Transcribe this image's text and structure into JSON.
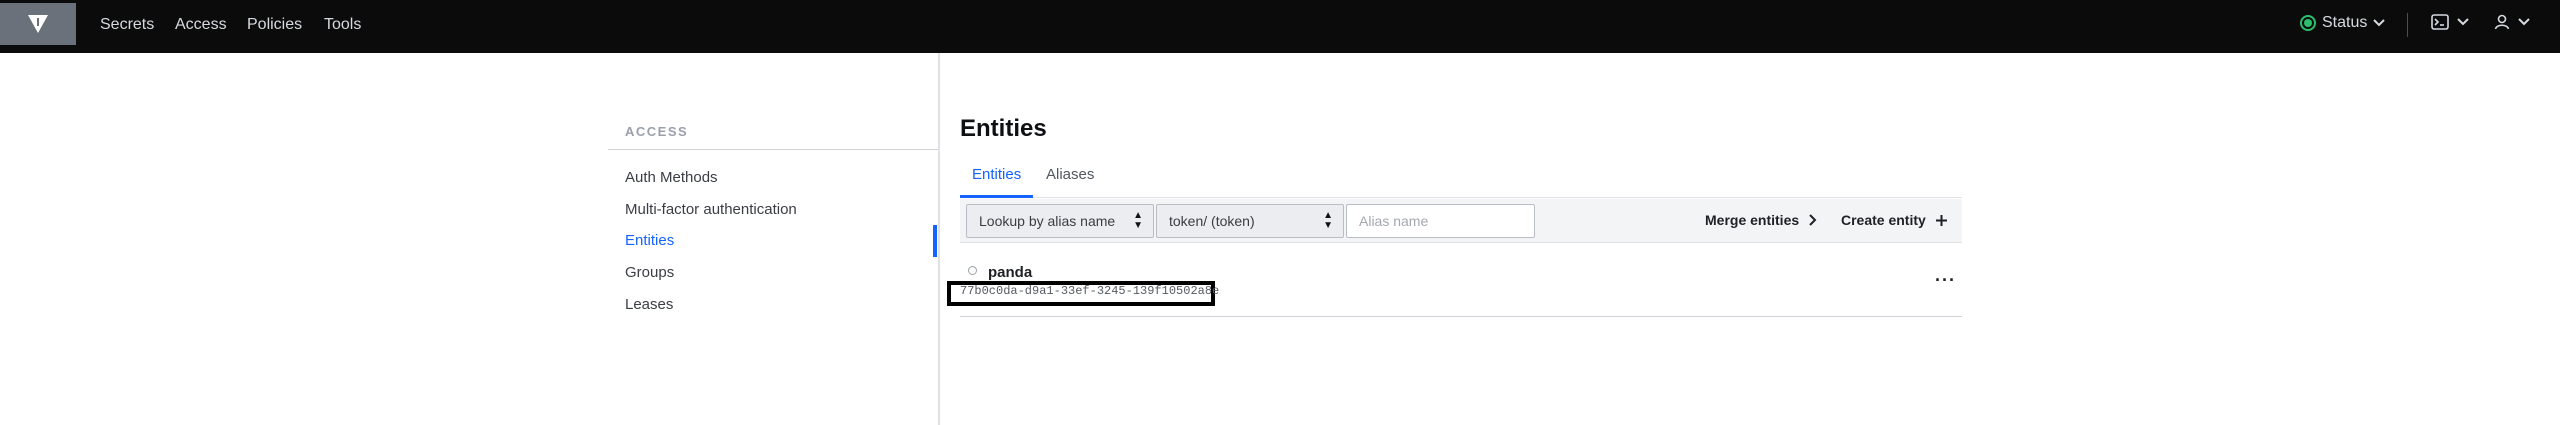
{
  "nav": {
    "links": [
      "Secrets",
      "Access",
      "Policies",
      "Tools"
    ],
    "status_label": "Status",
    "icons": [
      "vault-logo-icon",
      "console-icon",
      "user-icon"
    ]
  },
  "sidebar": {
    "heading": "ACCESS",
    "items": [
      {
        "label": "Auth Methods",
        "active": false
      },
      {
        "label": "Multi-factor authentication",
        "active": false
      },
      {
        "label": "Entities",
        "active": true
      },
      {
        "label": "Groups",
        "active": false
      },
      {
        "label": "Leases",
        "active": false
      }
    ]
  },
  "main": {
    "title": "Entities",
    "tabs": [
      {
        "label": "Entities",
        "active": true
      },
      {
        "label": "Aliases",
        "active": false
      }
    ],
    "toolbar": {
      "lookup_select": "Lookup by alias name",
      "mount_select": "token/ (token)",
      "alias_placeholder": "Alias name",
      "merge_label": "Merge entities",
      "create_label": "Create entity"
    },
    "entities": [
      {
        "name": "panda",
        "id": "77b0c0da-d9a1-33ef-3245-139f10502a8e"
      }
    ],
    "colors": {
      "accent": "#1563ff",
      "status_ok": "#2bbf6d",
      "nav_bg": "#0b0b0c"
    }
  }
}
